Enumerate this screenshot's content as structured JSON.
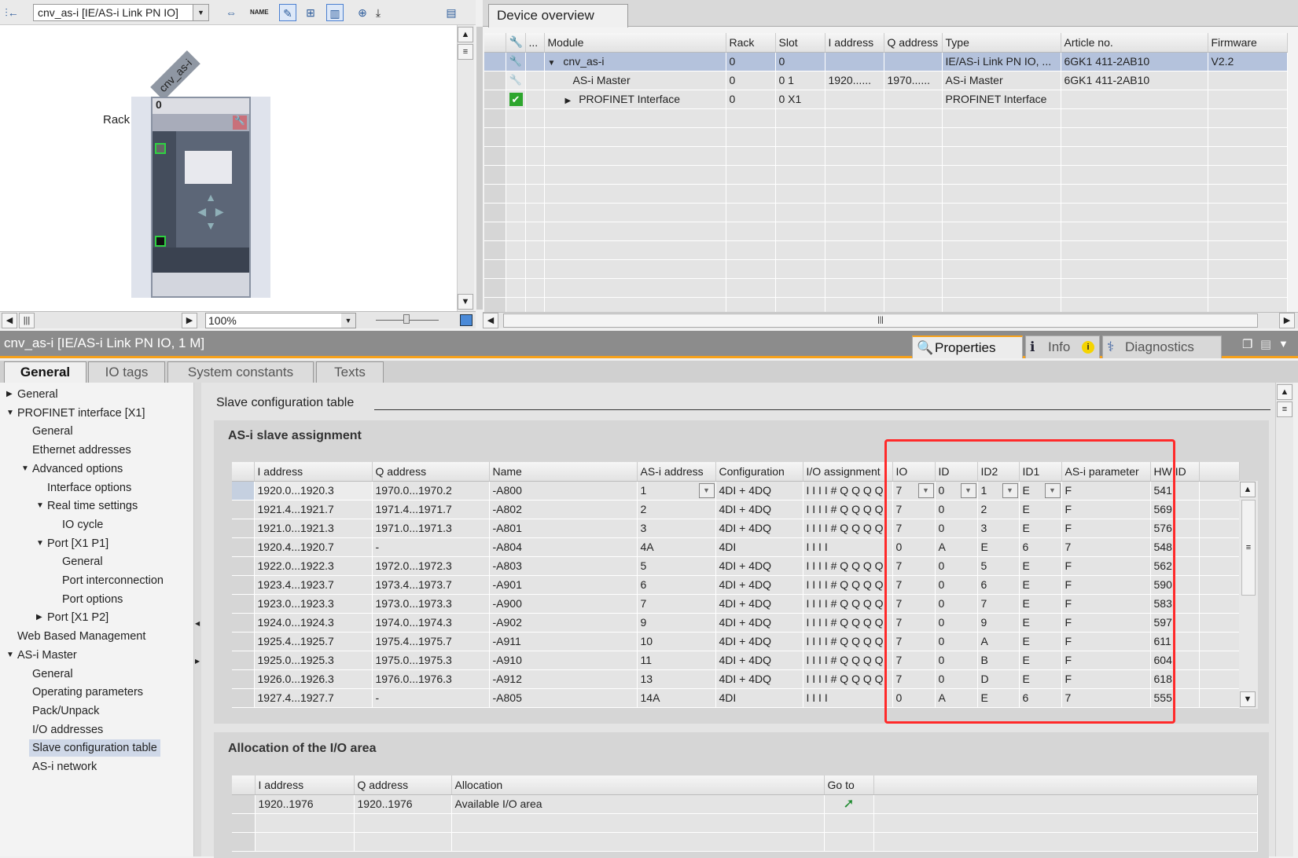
{
  "toolbar": {
    "device_select": "cnv_as-i [IE/AS-i Link PN IO]"
  },
  "device_view": {
    "device_label": "cnv_as-i",
    "rack_label": "Rack",
    "slot_number": "0",
    "zoom": "100%"
  },
  "device_overview": {
    "tab": "Device overview",
    "columns": [
      "",
      "...",
      "Module",
      "Rack",
      "Slot",
      "I address",
      "Q address",
      "Type",
      "Article no.",
      "Firmware"
    ],
    "rows": [
      {
        "module": "cnv_as-i",
        "rack": "0",
        "slot": "0",
        "i_address": "",
        "q_address": "",
        "type": "IE/AS-i Link PN IO, ...",
        "article": "6GK1 411-2AB10",
        "firmware": "V2.2",
        "expander": "▼",
        "status": "error"
      },
      {
        "module": "AS-i Master",
        "rack": "0",
        "slot": "0 1",
        "i_address": "1920......",
        "q_address": "1970......",
        "type": "AS-i Master",
        "article": "6GK1 411-2AB10",
        "firmware": "",
        "expander": "",
        "status": "error-faded"
      },
      {
        "module": "PROFINET Interface",
        "rack": "0",
        "slot": "0 X1",
        "i_address": "",
        "q_address": "",
        "type": "PROFINET Interface",
        "article": "",
        "firmware": "",
        "expander": "▶",
        "status": "ok"
      }
    ]
  },
  "inspector": {
    "title": "cnv_as-i [IE/AS-i Link PN IO, 1 M]",
    "panel_tabs": [
      "Properties",
      "Info",
      "Diagnostics"
    ],
    "tabs": [
      "General",
      "IO tags",
      "System constants",
      "Texts"
    ]
  },
  "tree": [
    {
      "label": "General",
      "level": 0,
      "arrow": "▶"
    },
    {
      "label": "PROFINET interface [X1]",
      "level": 0,
      "arrow": "▼"
    },
    {
      "label": "General",
      "level": 1,
      "arrow": ""
    },
    {
      "label": "Ethernet addresses",
      "level": 1,
      "arrow": ""
    },
    {
      "label": "Advanced options",
      "level": 1,
      "arrow": "▼"
    },
    {
      "label": "Interface options",
      "level": 2,
      "arrow": ""
    },
    {
      "label": "Real time settings",
      "level": 2,
      "arrow": "▼"
    },
    {
      "label": "IO cycle",
      "level": 3,
      "arrow": ""
    },
    {
      "label": "Port [X1 P1]",
      "level": 2,
      "arrow": "▼"
    },
    {
      "label": "General",
      "level": 3,
      "arrow": ""
    },
    {
      "label": "Port interconnection",
      "level": 3,
      "arrow": ""
    },
    {
      "label": "Port options",
      "level": 3,
      "arrow": ""
    },
    {
      "label": "Port [X1 P2]",
      "level": 2,
      "arrow": "▶"
    },
    {
      "label": "Web Based Management",
      "level": 0,
      "arrow": ""
    },
    {
      "label": "AS-i Master",
      "level": 0,
      "arrow": "▼"
    },
    {
      "label": "General",
      "level": 1,
      "arrow": ""
    },
    {
      "label": "Operating parameters",
      "level": 1,
      "arrow": ""
    },
    {
      "label": "Pack/Unpack",
      "level": 1,
      "arrow": ""
    },
    {
      "label": "I/O addresses",
      "level": 1,
      "arrow": ""
    },
    {
      "label": "Slave configuration table",
      "level": 1,
      "arrow": "",
      "selected": true
    },
    {
      "label": "AS-i network",
      "level": 1,
      "arrow": ""
    }
  ],
  "slave_config": {
    "section_title": "Slave configuration table",
    "box_title": "AS-i slave assignment",
    "columns": [
      "I address",
      "Q address",
      "Name",
      "AS-i address",
      "Configuration",
      "I/O assignment",
      "IO",
      "ID",
      "ID2",
      "ID1",
      "AS-i parameter",
      "HW ID"
    ],
    "rows": [
      [
        "1920.0...1920.3",
        "1970.0...1970.2",
        "-A800",
        "1",
        "4DI + 4DQ",
        "I I I I # Q Q Q Q",
        "7",
        "0",
        "1",
        "E",
        "F",
        "541"
      ],
      [
        "1921.4...1921.7",
        "1971.4...1971.7",
        "-A802",
        "2",
        "4DI + 4DQ",
        "I I I I # Q Q Q Q",
        "7",
        "0",
        "2",
        "E",
        "F",
        "569"
      ],
      [
        "1921.0...1921.3",
        "1971.0...1971.3",
        "-A801",
        "3",
        "4DI + 4DQ",
        "I I I I # Q Q Q Q",
        "7",
        "0",
        "3",
        "E",
        "F",
        "576"
      ],
      [
        "1920.4...1920.7",
        "-",
        "-A804",
        "4A",
        "4DI",
        "I I I I",
        "0",
        "A",
        "E",
        "6",
        "7",
        "548"
      ],
      [
        "1922.0...1922.3",
        "1972.0...1972.3",
        "-A803",
        "5",
        "4DI + 4DQ",
        "I I I I # Q Q Q Q",
        "7",
        "0",
        "5",
        "E",
        "F",
        "562"
      ],
      [
        "1923.4...1923.7",
        "1973.4...1973.7",
        "-A901",
        "6",
        "4DI + 4DQ",
        "I I I I # Q Q Q Q",
        "7",
        "0",
        "6",
        "E",
        "F",
        "590"
      ],
      [
        "1923.0...1923.3",
        "1973.0...1973.3",
        "-A900",
        "7",
        "4DI + 4DQ",
        "I I I I # Q Q Q Q",
        "7",
        "0",
        "7",
        "E",
        "F",
        "583"
      ],
      [
        "1924.0...1924.3",
        "1974.0...1974.3",
        "-A902",
        "9",
        "4DI + 4DQ",
        "I I I I # Q Q Q Q",
        "7",
        "0",
        "9",
        "E",
        "F",
        "597"
      ],
      [
        "1925.4...1925.7",
        "1975.4...1975.7",
        "-A911",
        "10",
        "4DI + 4DQ",
        "I I I I # Q Q Q Q",
        "7",
        "0",
        "A",
        "E",
        "F",
        "611"
      ],
      [
        "1925.0...1925.3",
        "1975.0...1975.3",
        "-A910",
        "11",
        "4DI + 4DQ",
        "I I I I # Q Q Q Q",
        "7",
        "0",
        "B",
        "E",
        "F",
        "604"
      ],
      [
        "1926.0...1926.3",
        "1976.0...1976.3",
        "-A912",
        "13",
        "4DI + 4DQ",
        "I I I I # Q Q Q Q",
        "7",
        "0",
        "D",
        "E",
        "F",
        "618"
      ],
      [
        "1927.4...1927.7",
        "-",
        "-A805",
        "14A",
        "4DI",
        "I I I I",
        "0",
        "A",
        "E",
        "6",
        "7",
        "555"
      ]
    ]
  },
  "allocation": {
    "box_title": "Allocation of the I/O area",
    "columns": [
      "I address",
      "Q address",
      "Allocation",
      "Go to"
    ],
    "rows": [
      [
        "1920..1976",
        "1920..1976",
        "Available I/O area"
      ]
    ]
  },
  "colors": {
    "highlight": "#ff2a2a",
    "accent": "#f7a21b",
    "selection": "#b4c2dc"
  }
}
